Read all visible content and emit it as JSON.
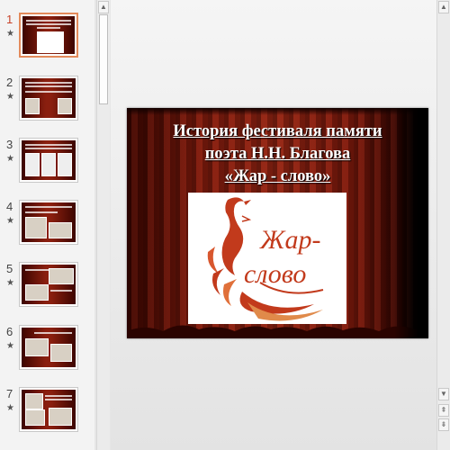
{
  "thumbnails": [
    {
      "number": "1",
      "star": "★"
    },
    {
      "number": "2",
      "star": "★"
    },
    {
      "number": "3",
      "star": "★"
    },
    {
      "number": "4",
      "star": "★"
    },
    {
      "number": "5",
      "star": "★"
    },
    {
      "number": "6",
      "star": "★"
    },
    {
      "number": "7",
      "star": "★"
    }
  ],
  "slide": {
    "title_line1": "История фестиваля памяти",
    "title_line2": "поэта Н.Н. Благова",
    "title_line3": "«Жар - слово»",
    "logo_word1": "Жар-",
    "logo_word2": "слово"
  },
  "scroll": {
    "up": "▲",
    "down": "▼",
    "prev_slide": "⇞",
    "next_slide": "⇟"
  },
  "colors": {
    "accent": "#c8432a",
    "curtain": "#8a1f0f",
    "logo": "#c23a1c"
  }
}
